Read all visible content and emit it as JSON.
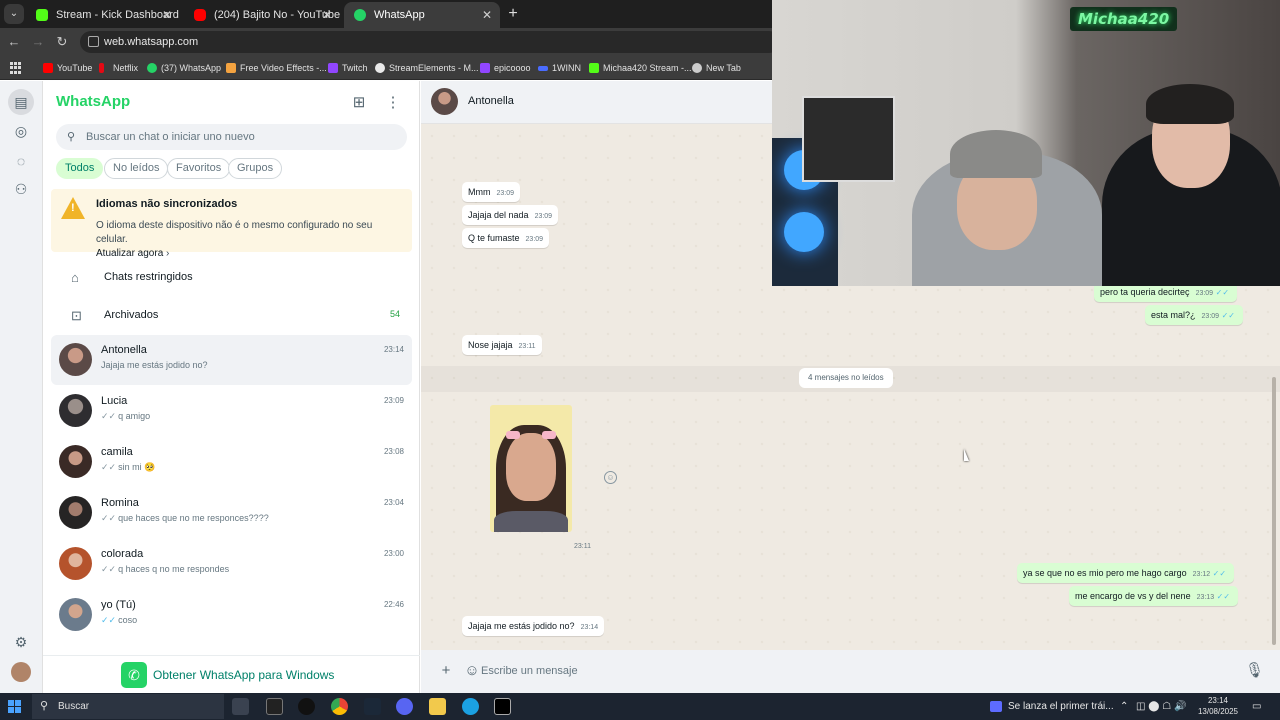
{
  "browser": {
    "tabs": [
      {
        "label": "Stream - Kick Dashboard",
        "favicon": "kick-icon",
        "color": "#53fc18"
      },
      {
        "label": "(204) Bajito No - YouTube",
        "favicon": "youtube-icon",
        "color": "#ff0000"
      },
      {
        "label": "WhatsApp",
        "favicon": "whatsapp-icon",
        "color": "#25d366"
      }
    ],
    "url": "web.whatsapp.com",
    "bookmarks": [
      {
        "label": "YouTube",
        "color": "#ff0000"
      },
      {
        "label": "Netflix",
        "color": "#e50914"
      },
      {
        "label": "(37) WhatsApp",
        "color": "#25d366"
      },
      {
        "label": "Free Video Effects -...",
        "color": "#f4a340"
      },
      {
        "label": "Twitch",
        "color": "#9146ff"
      },
      {
        "label": "StreamElements - M...",
        "color": "#e9e9e9"
      },
      {
        "label": "epicoooo",
        "color": "#9146ff"
      },
      {
        "label": "1WINN",
        "color": "#4a6cff"
      },
      {
        "label": "Michaa420 Stream -...",
        "color": "#53fc18"
      },
      {
        "label": "New Tab",
        "color": "#cccccc"
      }
    ]
  },
  "sidebar": {
    "title": "WhatsApp",
    "search_placeholder": "Buscar un chat o iniciar uno nuevo",
    "filters": [
      "Todos",
      "No leídos",
      "Favoritos",
      "Grupos"
    ],
    "banner": {
      "title": "Idiomas não sincronizados",
      "text": "O idioma deste dispositivo não é o mesmo configurado no seu celular.",
      "link": "Atualizar agora"
    },
    "restricted": "Chats restringidos",
    "archived": "Archivados",
    "archived_count": "54",
    "chats": [
      {
        "name": "Antonella",
        "time": "23:14",
        "preview": "Jajaja me estás jodido no?",
        "tick": ""
      },
      {
        "name": "Lucia",
        "time": "23:09",
        "preview": "q amigo",
        "tick": "✓✓"
      },
      {
        "name": "camila",
        "time": "23:08",
        "preview": "sin mi 🥺",
        "tick": "✓✓"
      },
      {
        "name": "Romina",
        "time": "23:04",
        "preview": "que haces que no me responces????",
        "tick": "✓✓"
      },
      {
        "name": "colorada",
        "time": "23:00",
        "preview": "q haces q no me respondes",
        "tick": "✓✓"
      },
      {
        "name": "yo (Tú)",
        "time": "22:46",
        "preview": "coso",
        "tick": "✓✓"
      }
    ],
    "get_app": "Obtener WhatsApp para Windows"
  },
  "chat": {
    "contact": "Antonella",
    "messages_in": [
      {
        "text": "Mmm",
        "time": "23:09"
      },
      {
        "text": "Jajaja del nada",
        "time": "23:09"
      },
      {
        "text": "Q te fumaste",
        "time": "23:09"
      },
      {
        "text": "Nose jajaja",
        "time": "23:11"
      },
      {
        "text": "Jajaja me estás jodido no?",
        "time": "23:14"
      }
    ],
    "messages_out": [
      {
        "text": "pero ta queria decirteç",
        "time": "23:09",
        "tick": "✓✓"
      },
      {
        "text": "esta mal?¿",
        "time": "23:09",
        "tick": "✓✓"
      },
      {
        "text": "ya se que no es mio pero me hago cargo",
        "time": "23:12",
        "tick": "✓✓"
      },
      {
        "text": "me encargo de vs y del nene",
        "time": "23:13",
        "tick": "✓✓"
      }
    ],
    "unread_label": "4 mensajes no leídos",
    "photo_time": "23:11",
    "composer_placeholder": "Escribe un mensaje"
  },
  "webcam": {
    "sign": "Michaa420"
  },
  "taskbar": {
    "search": "Buscar",
    "news": "Se lanza el primer trái...",
    "time": "23:14",
    "date": "13/08/2025"
  }
}
